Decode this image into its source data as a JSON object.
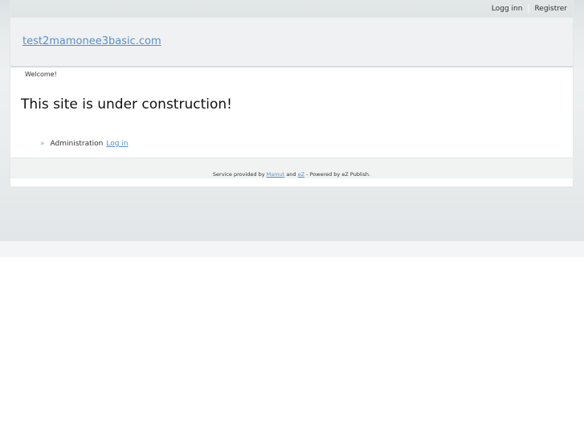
{
  "topbar": {
    "login_label": "Logg inn",
    "register_label": "Registrer"
  },
  "header": {
    "site_name": "test2mamonee3basic.com"
  },
  "main": {
    "welcome": "Welcome!",
    "title": "This site is under construction!",
    "admin_label": "Administration",
    "admin_link": "Log in"
  },
  "footer": {
    "service_prefix": "Service provided by",
    "mamut_link": "Mamut",
    "and_text": "and",
    "ez_link": "eZ",
    "powered_text": "- Powered by eZ Publish."
  }
}
